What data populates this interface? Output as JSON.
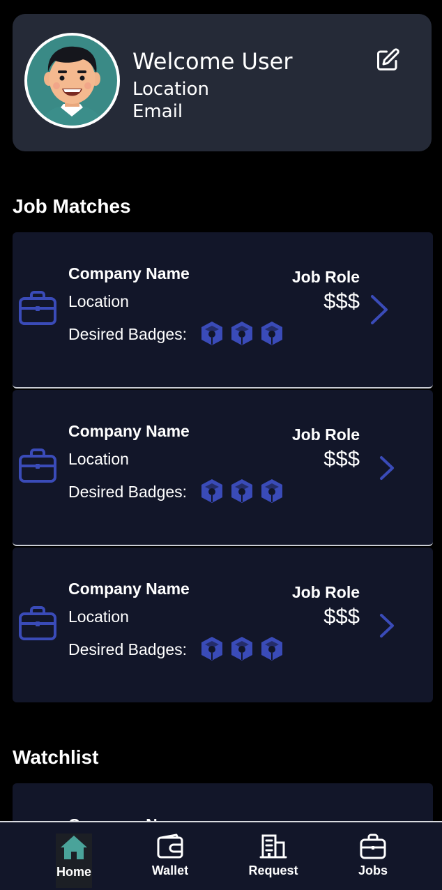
{
  "profile": {
    "welcome": "Welcome User",
    "location": "Location",
    "email": "Email",
    "avatar_icon": "user-avatar-illustration",
    "edit_icon": "edit-icon"
  },
  "sections": {
    "job_matches_title": "Job Matches",
    "watchlist_title": "Watchlist"
  },
  "job_matches": [
    {
      "company": "Company Name",
      "location": "Location",
      "badges_label": "Desired Badges:",
      "role": "Job Role",
      "pay": "$$$"
    },
    {
      "company": "Company Name",
      "location": "Location",
      "badges_label": "Desired Badges:",
      "role": "Job Role",
      "pay": "$$$"
    },
    {
      "company": "Company Name",
      "location": "Location",
      "badges_label": "Desired Badges:",
      "role": "Job Role",
      "pay": "$$$"
    }
  ],
  "watchlist": [
    {
      "company": "Company Name"
    }
  ],
  "nav": {
    "items": [
      {
        "label": "Home",
        "icon": "home-icon",
        "active": true
      },
      {
        "label": "Wallet",
        "icon": "wallet-icon",
        "active": false
      },
      {
        "label": "Request",
        "icon": "building-icon",
        "active": false
      },
      {
        "label": "Jobs",
        "icon": "briefcase-icon",
        "active": false
      }
    ]
  },
  "colors": {
    "background": "#000000",
    "card": "#252a37",
    "job_card": "#121629",
    "accent_blue": "#3a4bb8",
    "home_active": "#4aa39a"
  }
}
